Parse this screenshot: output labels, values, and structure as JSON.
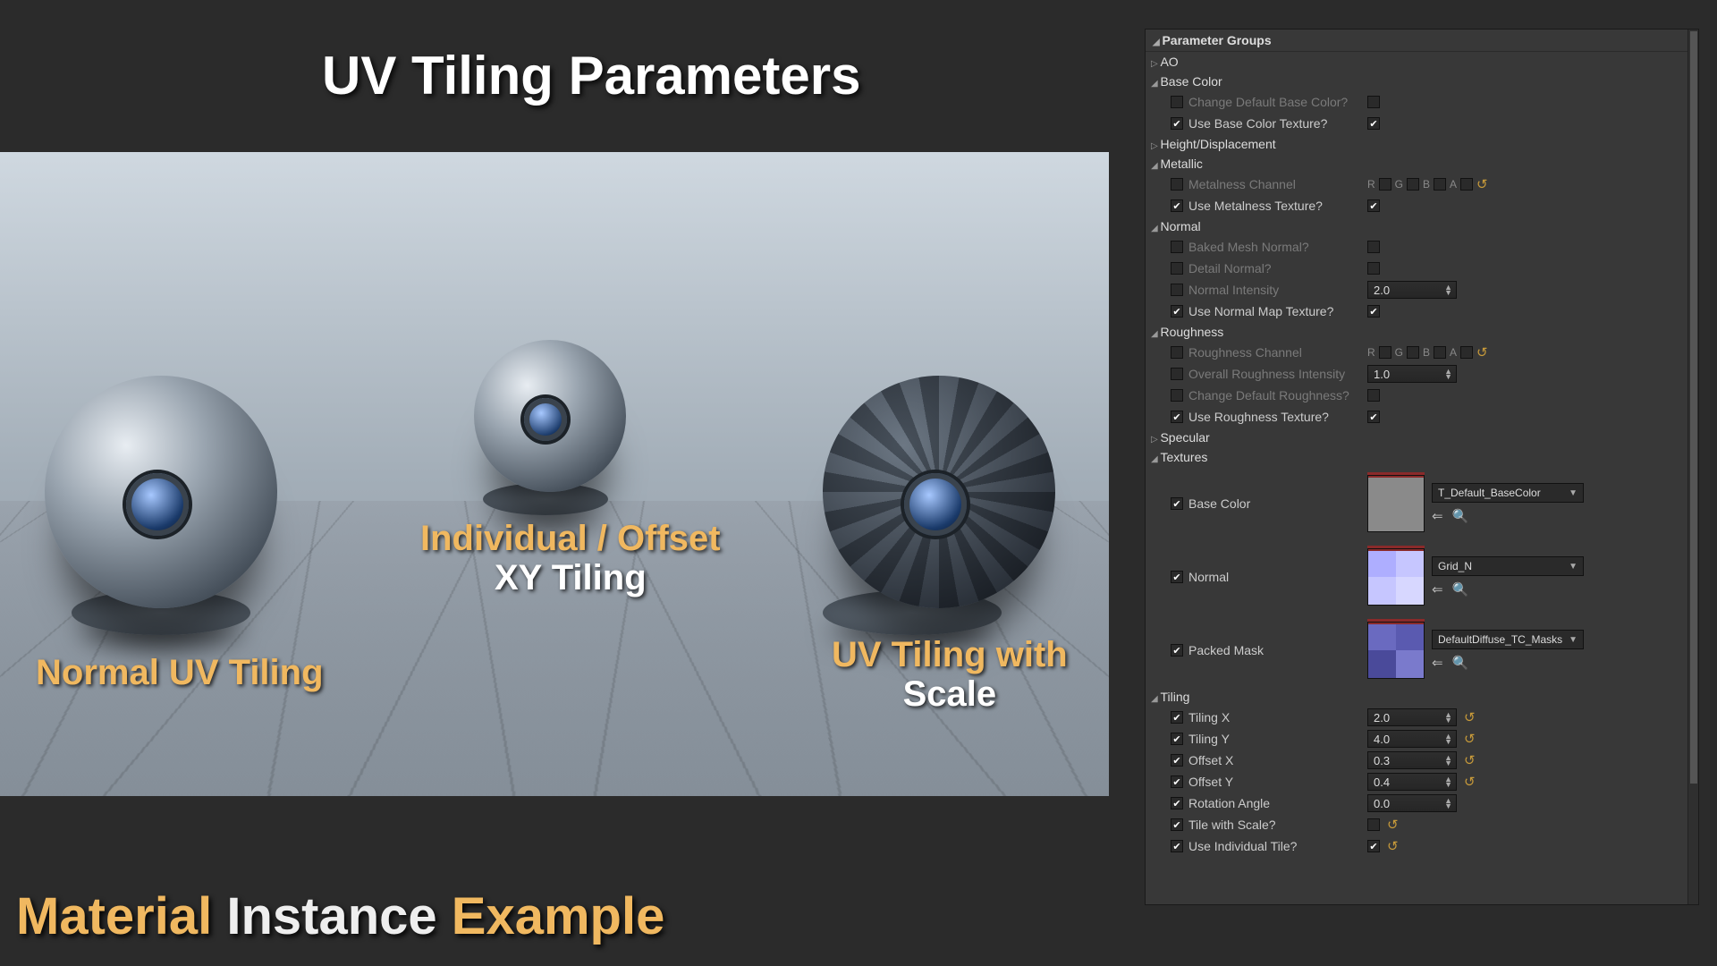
{
  "titles": {
    "main": "UV Tiling Parameters",
    "bottom_accent": "Material",
    "bottom_white1": "Instance",
    "bottom_accent2": "Example"
  },
  "viewport_labels": {
    "left": "Normal UV Tiling",
    "mid_line1": "Individual / Offset",
    "mid_line2": "XY Tiling",
    "right_line1": "UV Tiling with",
    "right_line2": "Scale"
  },
  "panel": {
    "header": "Parameter Groups",
    "groups": {
      "ao": "AO",
      "basecolor": "Base Color",
      "height": "Height/Displacement",
      "metallic": "Metallic",
      "normal": "Normal",
      "roughness": "Roughness",
      "specular": "Specular",
      "textures": "Textures",
      "tiling": "Tiling"
    },
    "params": {
      "change_default_base": "Change Default Base Color?",
      "use_base_tex": "Use Base Color Texture?",
      "metalness_channel": "Metalness Channel",
      "use_metalness_tex": "Use Metalness Texture?",
      "baked_mesh_normal": "Baked Mesh Normal?",
      "detail_normal": "Detail Normal?",
      "normal_intensity": "Normal Intensity",
      "use_normal_map_tex": "Use Normal Map Texture?",
      "roughness_channel": "Roughness Channel",
      "overall_roughness_intensity": "Overall Roughness Intensity",
      "change_default_roughness": "Change Default Roughness?",
      "use_roughness_tex": "Use Roughness Texture?",
      "tex_basecolor_lbl": "Base Color",
      "tex_normal_lbl": "Normal",
      "tex_packed_lbl": "Packed Mask",
      "tiling_x": "Tiling X",
      "tiling_y": "Tiling Y",
      "offset_x": "Offset X",
      "offset_y": "Offset Y",
      "rotation_angle": "Rotation Angle",
      "tile_with_scale": "Tile with Scale?",
      "use_individual_tile": "Use Individual Tile?"
    },
    "values": {
      "normal_intensity": "2.0",
      "overall_roughness_intensity": "1.0",
      "tex_basecolor": "T_Default_BaseColor",
      "tex_normal": "Grid_N",
      "tex_masks": "DefaultDiffuse_TC_Masks",
      "tiling_x": "2.0",
      "tiling_y": "4.0",
      "offset_x": "0.3",
      "offset_y": "0.4",
      "rotation_angle": "0.0"
    },
    "rgba": {
      "r": "R",
      "g": "G",
      "b": "B",
      "a": "A"
    }
  }
}
